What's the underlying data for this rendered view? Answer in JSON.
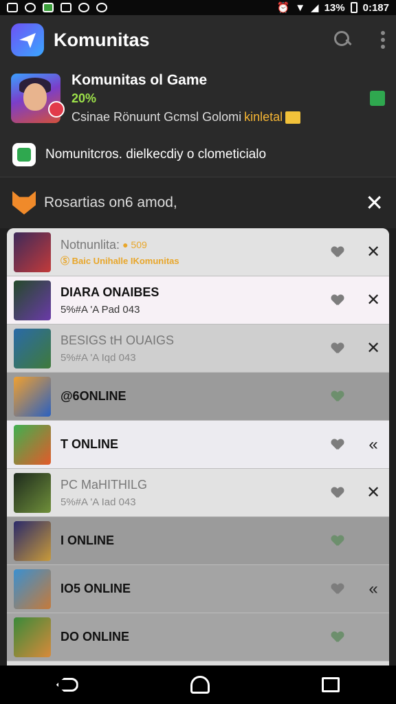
{
  "status_bar": {
    "battery_pct": "13%",
    "time": "0:187"
  },
  "app_bar": {
    "title": "Komunitas",
    "icons": [
      "app-logo-icon",
      "search-icon",
      "more-vert-icon"
    ]
  },
  "game_card": {
    "name": "Komunitas ol Game",
    "percent": "20%",
    "desc_prefix": "Csinae Rönuunt Gcmsl Golomi",
    "desc_highlight": "kinletal"
  },
  "notice": {
    "text": "Nomunitcros. dielkecdiy o clometicialo"
  },
  "section": {
    "title": "Rosartias on6 amod,",
    "close": "✕"
  },
  "list": [
    {
      "title": "Notnunlita:",
      "title_extra": "● 509",
      "sub": "Ⓢ Baic Unihalle IKomunitas",
      "style": "grey1",
      "thumb": "t1",
      "faded": true,
      "sub_gold": true,
      "action": "✕"
    },
    {
      "title": "DIARA ONAIBES",
      "sub": "5%#A 'A Pad 043",
      "style": "white",
      "thumb": "t2",
      "faded": false,
      "action": "✕"
    },
    {
      "title": "BESIGS tH OUAIGS",
      "sub": "5%#A 'A Iqd 043",
      "style": "grey2",
      "thumb": "t3",
      "faded": true,
      "action": "✕"
    },
    {
      "title": "@6ONLINE",
      "sub": "",
      "style": "dark",
      "thumb": "t4",
      "faded": false,
      "action": ""
    },
    {
      "title": "T ONLINE",
      "sub": "",
      "style": "light",
      "thumb": "t5",
      "faded": false,
      "action": "«"
    },
    {
      "title": "PC MaHITHILG",
      "sub": "5%#A 'A Iad 043",
      "style": "grey1",
      "thumb": "t6",
      "faded": true,
      "action": "✕"
    },
    {
      "title": "I ONLINE",
      "sub": "",
      "style": "dark",
      "thumb": "t7",
      "faded": false,
      "action": ""
    },
    {
      "title": "IO5 ONLINE",
      "sub": "",
      "style": "dark2",
      "thumb": "t8",
      "faded": false,
      "action": "«"
    },
    {
      "title": "DO ONLINE",
      "sub": "",
      "style": "dark2",
      "thumb": "t9",
      "faded": false,
      "action": ""
    }
  ],
  "nav": {
    "icons": [
      "back-icon",
      "home-icon",
      "recents-icon"
    ]
  }
}
